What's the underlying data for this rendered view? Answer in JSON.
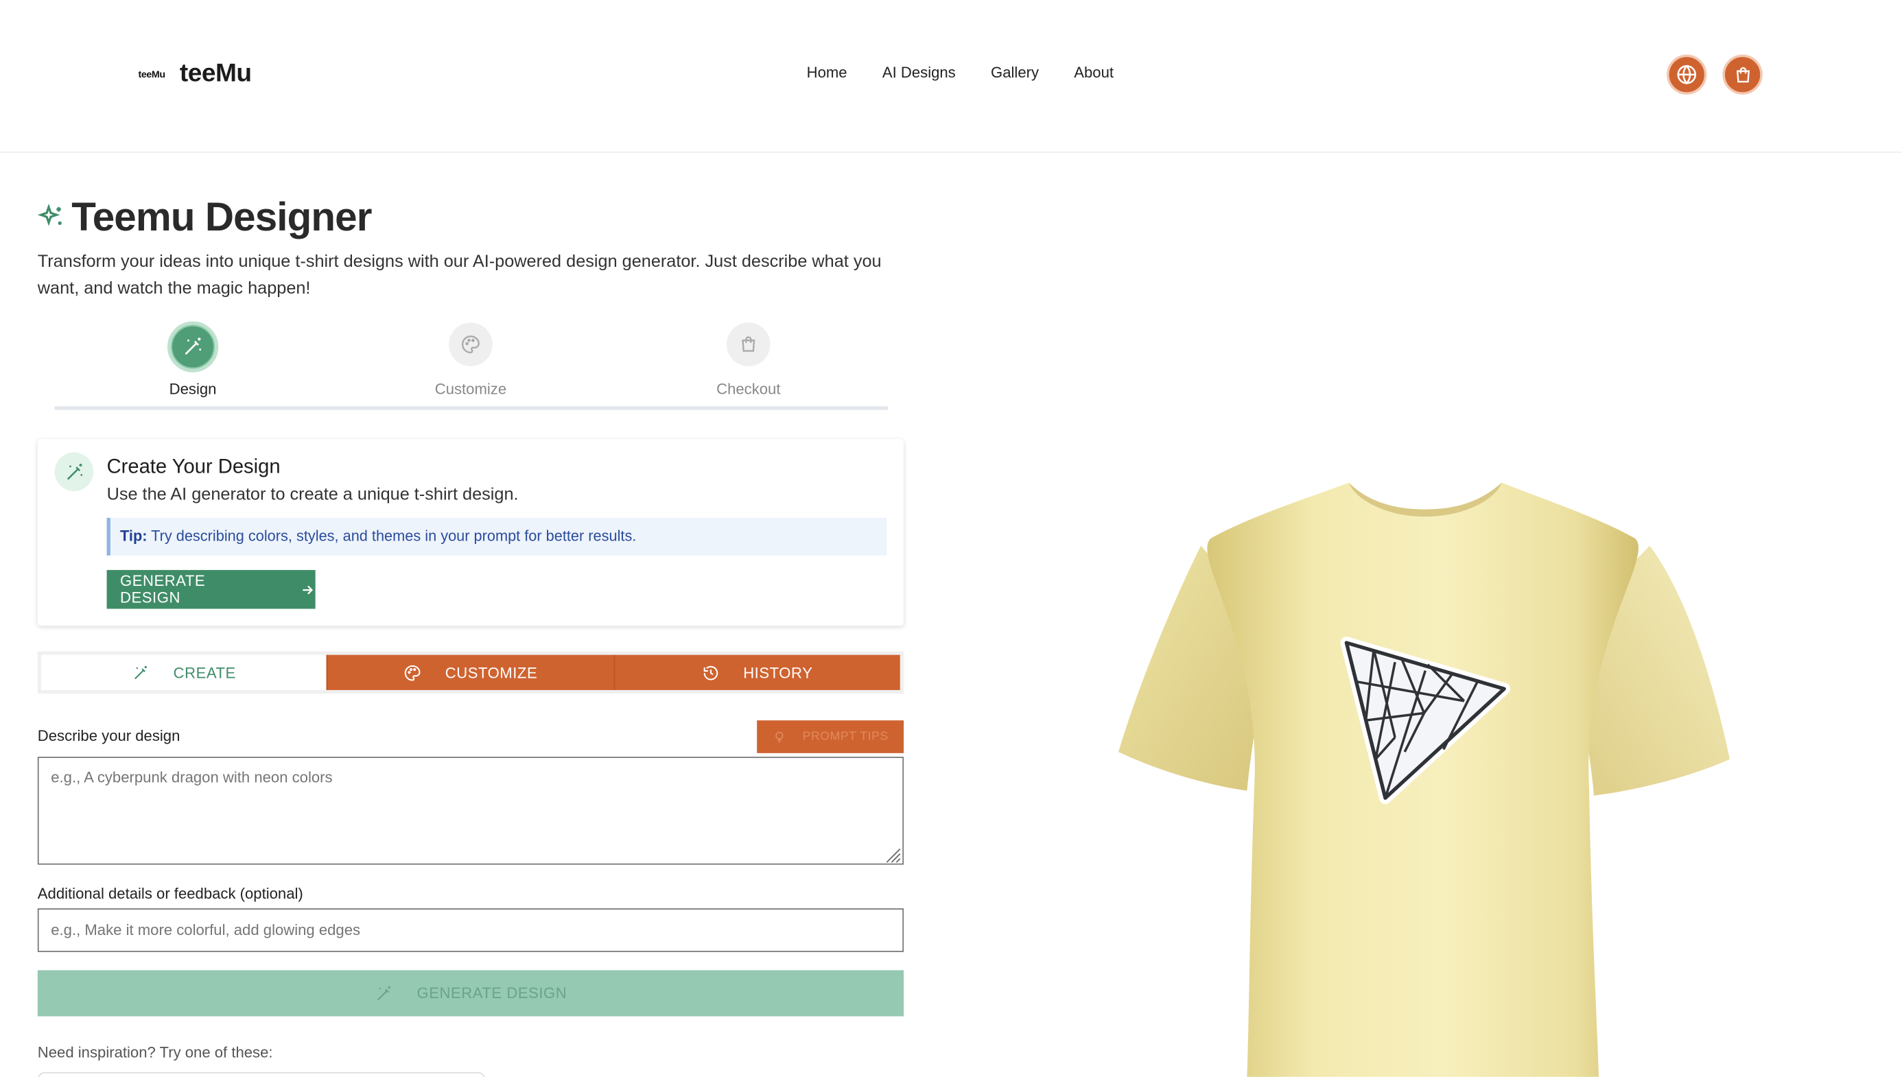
{
  "header": {
    "brand_small": "teeMu",
    "brand_big": "teeMu",
    "nav": [
      "Home",
      "AI Designs",
      "Gallery",
      "About"
    ],
    "icons": [
      "globe-icon",
      "cart-icon"
    ],
    "accent_color": "#cf6330"
  },
  "page": {
    "title": "Teemu Designer",
    "intro": "Transform your ideas into unique t-shirt designs with our AI-powered design generator. Just describe what you want, and watch the magic happen!"
  },
  "stepper": {
    "steps": [
      "Design",
      "Customize",
      "Checkout"
    ],
    "active_index": 0
  },
  "card": {
    "title": "Create Your Design",
    "subtitle": "Use the AI generator to create a unique t-shirt design.",
    "tip_label": "Tip:",
    "tip_text": "Try describing colors, styles, and themes in your prompt for better results.",
    "button": "GENERATE DESIGN"
  },
  "tabs": [
    "CREATE",
    "CUSTOMIZE",
    "HISTORY"
  ],
  "form": {
    "describe_label": "Describe your design",
    "prompt_tips": "PROMPT TIPS",
    "describe_placeholder": "e.g., A cyberpunk dragon with neon colors",
    "details_label": "Additional details or feedback (optional)",
    "details_placeholder": "e.g., Make it more colorful, add glowing edges",
    "generate_button": "GENERATE DESIGN",
    "inspiration": "Need inspiration? Try one of these:"
  },
  "colors": {
    "brand_green": "#3f8d68",
    "disabled_green": "#95c9b1",
    "shirt": "#f1e8a6"
  }
}
